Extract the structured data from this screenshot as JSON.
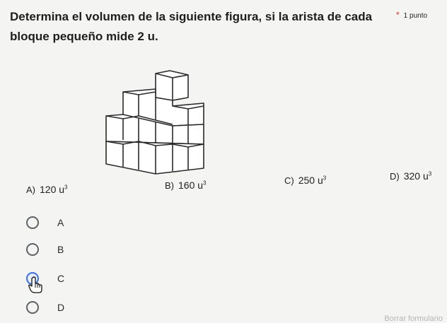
{
  "question": {
    "text": "Determina el volumen de la siguiente figura, si la arista de cada bloque pequeño mide 2 u.",
    "required_mark": "*",
    "points": "1 punto"
  },
  "answers": [
    {
      "letter": "A)",
      "value": "120 u",
      "exp": "3"
    },
    {
      "letter": "B)",
      "value": "160 u",
      "exp": "3"
    },
    {
      "letter": "C)",
      "value": "250 u",
      "exp": "3"
    },
    {
      "letter": "D)",
      "value": "320 u",
      "exp": "3"
    }
  ],
  "choices": [
    {
      "label": "A",
      "selected": false
    },
    {
      "label": "B",
      "selected": false
    },
    {
      "label": "C",
      "selected": true
    },
    {
      "label": "D",
      "selected": false
    }
  ],
  "footer": {
    "link": "Borrar formulario"
  },
  "colors": {
    "accent": "#3c6ee0",
    "radio_border": "#5f6368"
  }
}
